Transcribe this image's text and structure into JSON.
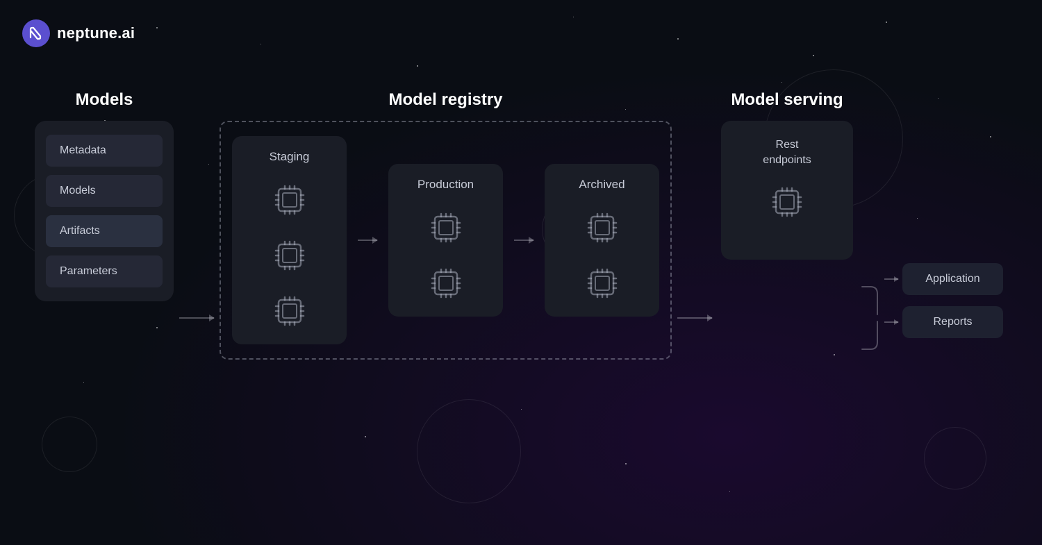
{
  "logo": {
    "text": "neptune.ai"
  },
  "sections": {
    "models": {
      "title": "Models",
      "menu_items": [
        {
          "label": "Metadata",
          "active": false
        },
        {
          "label": "Models",
          "active": false
        },
        {
          "label": "Artifacts",
          "active": true
        },
        {
          "label": "Parameters",
          "active": false
        }
      ]
    },
    "registry": {
      "title": "Model registry",
      "stages": [
        {
          "label": "Staging",
          "icons": 3
        },
        {
          "label": "Production",
          "icons": 2
        },
        {
          "label": "Archived",
          "icons": 2
        }
      ]
    },
    "serving": {
      "title": "Model serving",
      "panel_title": "Rest\nendpoints"
    },
    "outputs": [
      {
        "label": "Application"
      },
      {
        "label": "Reports"
      }
    ]
  }
}
